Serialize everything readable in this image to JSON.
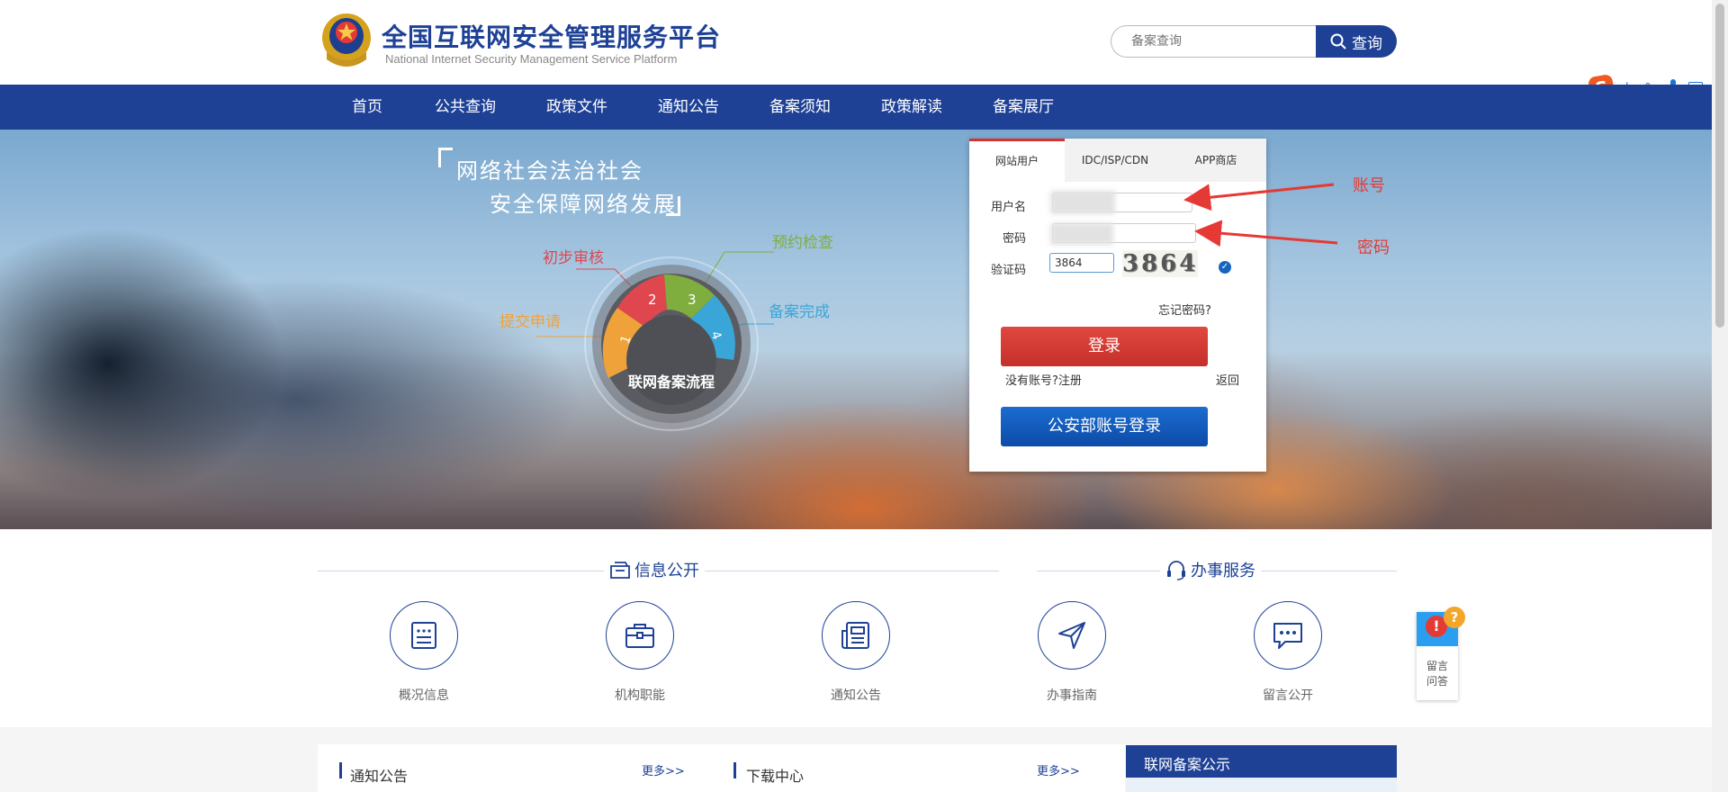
{
  "header": {
    "title": "全国互联网安全管理服务平台",
    "subtitle": "National Internet Security Management Service Platform",
    "search_placeholder": "备案查询",
    "search_button": "查询"
  },
  "ime": {
    "logo": "S",
    "items": [
      "中",
      "°,",
      "mic-icon",
      "keyboard-icon",
      "grid-icon"
    ],
    "lang": "中",
    "punct": "°,"
  },
  "nav": {
    "items": [
      "首页",
      "公共查询",
      "政策文件",
      "通知公告",
      "备案须知",
      "政策解读",
      "备案展厅"
    ]
  },
  "banner": {
    "slogan_line1": "网络社会法治社会",
    "slogan_line2": "安全保障网络发展",
    "process_title": "联网备案流程",
    "steps": [
      {
        "num": "1",
        "label": "提交申请",
        "color": "#f0a23a"
      },
      {
        "num": "2",
        "label": "初步审核",
        "color": "#e0464d"
      },
      {
        "num": "3",
        "label": "预约检查",
        "color": "#7fae3e"
      },
      {
        "num": "4",
        "label": "备案完成",
        "color": "#3aa6d8"
      }
    ]
  },
  "login": {
    "tabs": [
      "网站用户",
      "IDC/ISP/CDN",
      "APP商店"
    ],
    "active_tab": "网站用户",
    "username_label": "用户名",
    "password_label": "密码",
    "captcha_label": "验证码",
    "captcha_value": "3864",
    "captcha_image_text": "3864",
    "forgot": "忘记密码?",
    "login_button": "登录",
    "register": "没有账号?注册",
    "back": "返回",
    "police_login_button": "公安部账号登录"
  },
  "annotations": {
    "account": "账号",
    "password": "密码"
  },
  "sections": {
    "info_title": "信息公开",
    "service_title": "办事服务",
    "items": [
      {
        "label": "概况信息",
        "icon": "document-list-icon"
      },
      {
        "label": "机构职能",
        "icon": "briefcase-icon"
      },
      {
        "label": "通知公告",
        "icon": "newspaper-icon"
      },
      {
        "label": "办事指南",
        "icon": "navigation-arrow-icon"
      },
      {
        "label": "留言公开",
        "icon": "chat-bubble-icon"
      }
    ]
  },
  "bottom": {
    "notice_title": "通知公告",
    "notice_more": "更多>>",
    "download_title": "下载中心",
    "download_more": "更多>>",
    "gongshi_title": "联网备案公示"
  },
  "float_qa": {
    "text_line1": "留言",
    "text_line2": "问答",
    "badge": "?",
    "alert": "!"
  }
}
